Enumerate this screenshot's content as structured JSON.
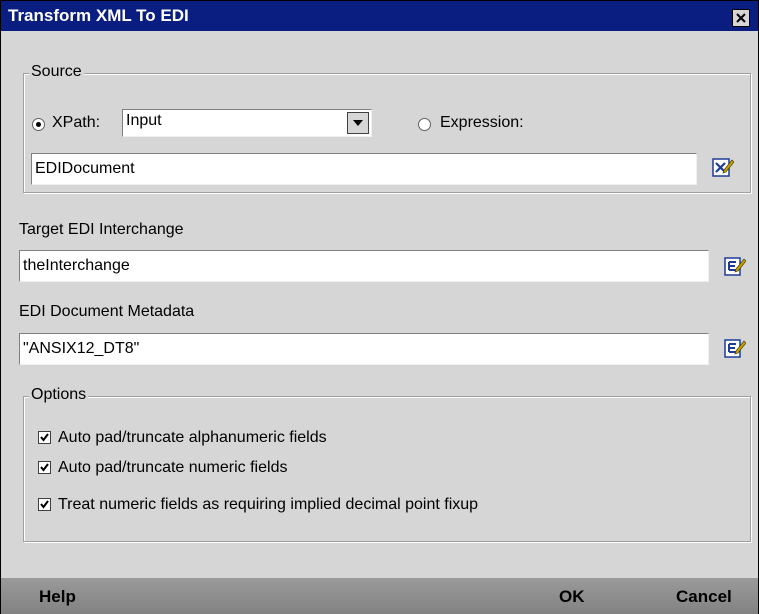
{
  "window": {
    "title": "Transform XML To EDI"
  },
  "source": {
    "legend": "Source",
    "xpath_label": "XPath:",
    "xpath_value": "Input",
    "expression_label": "Expression:",
    "field_value": "EDIDocument"
  },
  "target": {
    "label": "Target EDI Interchange",
    "value": "theInterchange"
  },
  "metadata": {
    "label": "EDI Document Metadata",
    "value": "\"ANSIX12_DT8\""
  },
  "options": {
    "legend": "Options",
    "items": [
      {
        "label": "Auto pad/truncate alphanumeric fields",
        "checked": true
      },
      {
        "label": "Auto pad/truncate numeric fields",
        "checked": true
      },
      {
        "label": "Treat numeric fields as requiring implied decimal point fixup",
        "checked": true
      }
    ]
  },
  "buttons": {
    "help": "Help",
    "ok": "OK",
    "cancel": "Cancel"
  },
  "colors": {
    "titlebar": "#0a1e82",
    "dialog_bg": "#d6d6d6",
    "bottombar": "#8c8c8c"
  }
}
